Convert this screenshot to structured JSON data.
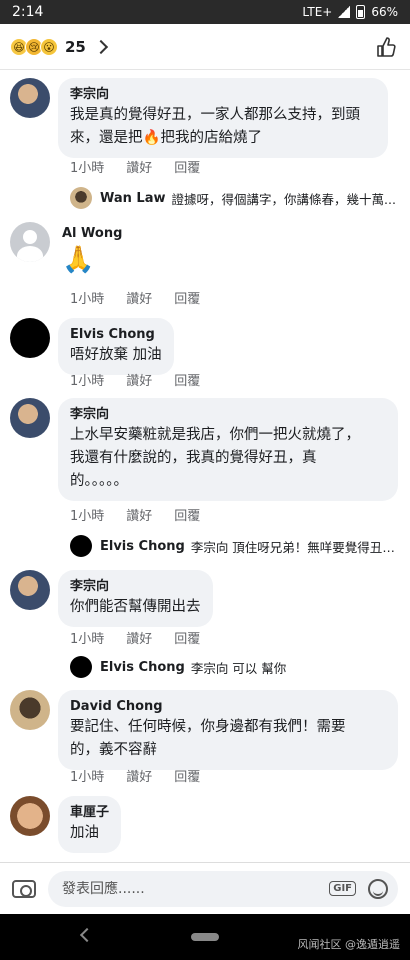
{
  "status_bar": {
    "time": "2:14",
    "network": "LTE+",
    "battery": "66%"
  },
  "reactions": {
    "count": "25",
    "emojis": [
      "😆",
      "😢",
      "😮"
    ]
  },
  "actions": {
    "time": "1小時",
    "like": "讚好",
    "reply": "回覆"
  },
  "comments": [
    {
      "author": "李宗向",
      "lines": [
        "我是真的覺得好丑，一家人都那么支持，到頭",
        "來，還是把🔥把我的店給燒了"
      ]
    },
    {
      "author": "Al Wong",
      "emoji": "🙏"
    },
    {
      "author": "Elvis Chong",
      "lines": [
        "唔好放棄 加油"
      ]
    },
    {
      "author": "李宗向",
      "lines": [
        "上水早安藥粧就是我店，你們一把火就燒了，",
        "我還有什麼說的，我真的覺得好丑，真",
        "的。。。。。"
      ]
    },
    {
      "author": "李宗向",
      "lines": [
        "你們能否幫傳開出去"
      ]
    },
    {
      "author": "David  Chong",
      "lines": [
        "要記住、任何時候，你身邊都有我們！需要",
        "的，義不容辭"
      ]
    },
    {
      "author": "車厘子",
      "lines": [
        "加油"
      ]
    }
  ],
  "replies": [
    {
      "author": "Wan Law",
      "text": "證據呀，得個講字，你講條春，幾十萬..."
    },
    {
      "author": "Elvis Chong",
      "text": "李宗向 頂住呀兄弟！無咩要覺得丑，..."
    },
    {
      "author": "Elvis Chong",
      "text": "李宗向 可以 幫你"
    }
  ],
  "composer": {
    "placeholder": "發表回應......",
    "gif": "GIF"
  },
  "watermark": "风闻社区 @逸遁逍遥"
}
